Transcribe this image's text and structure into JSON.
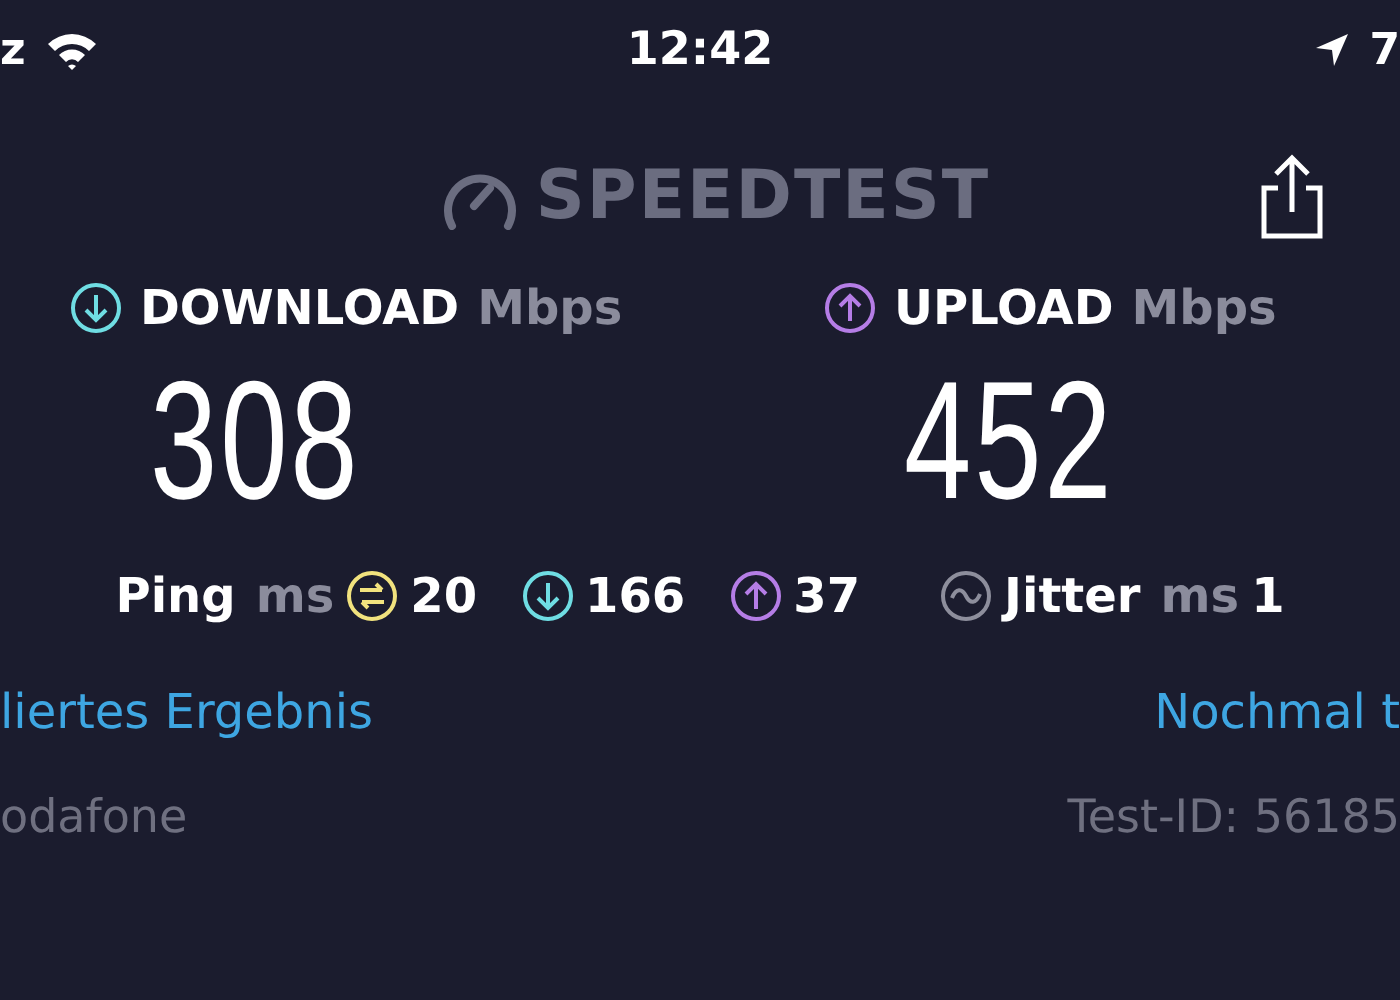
{
  "status_bar": {
    "left_text": "z",
    "time": "12:42",
    "right_text": "7"
  },
  "header": {
    "logo": "SPEEDTEST"
  },
  "results": [
    {
      "kind": "download",
      "label": "DOWNLOAD",
      "unit": "Mbps",
      "value": "308"
    },
    {
      "kind": "upload",
      "label": "UPLOAD",
      "unit": "Mbps",
      "value": "452"
    }
  ],
  "stats": [
    {
      "kind": "ping",
      "label": "Ping",
      "unit": "ms",
      "value": "20"
    },
    {
      "kind": "download",
      "value": "166"
    },
    {
      "kind": "upload",
      "value": "37"
    },
    {
      "kind": "jitter",
      "label": "Jitter",
      "unit": "ms",
      "value": "1"
    }
  ],
  "links": {
    "left": "liertes Ergebnis",
    "right": "Nochmal t"
  },
  "footer": {
    "left": "odafone",
    "right": "Test-ID: 56185"
  }
}
